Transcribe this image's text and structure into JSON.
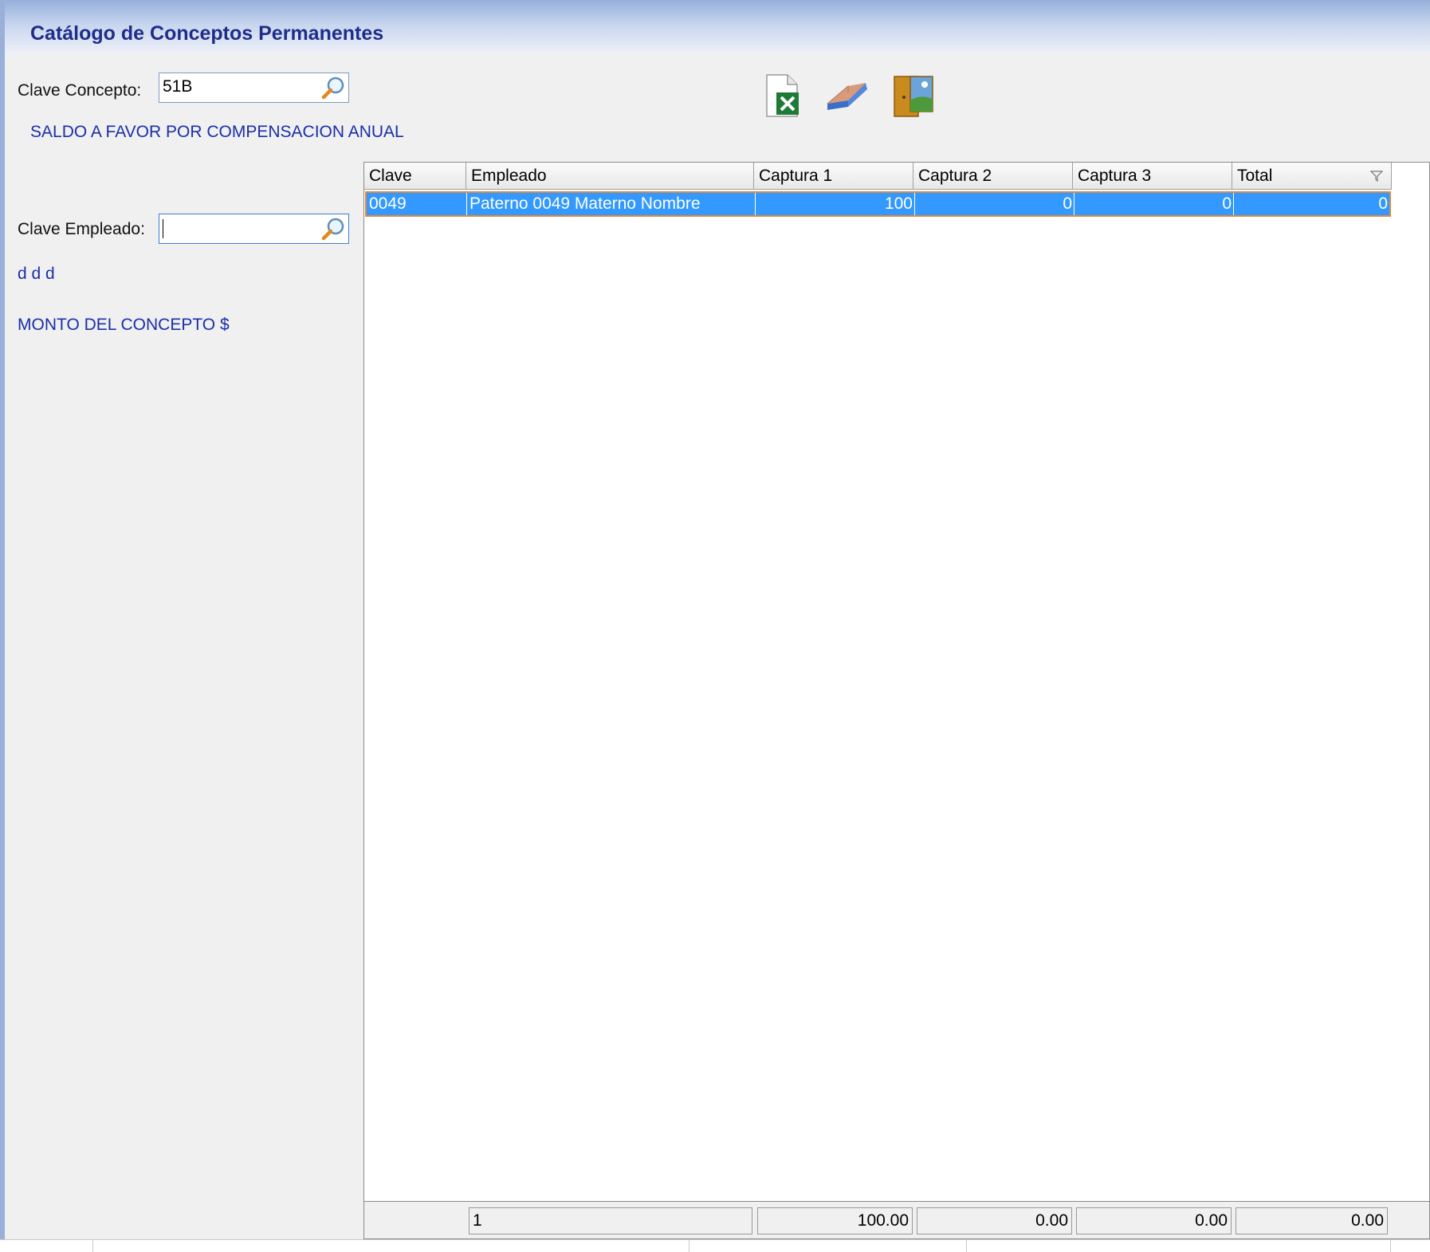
{
  "window": {
    "title": "Catálogo de Conceptos Permanentes"
  },
  "concepto": {
    "label": "Clave Concepto:",
    "value": "51B",
    "description": "SALDO A FAVOR POR COMPENSACION ANUAL"
  },
  "empleado": {
    "label": "Clave Empleado:",
    "value": "",
    "name": "d d d",
    "monto_label": "MONTO DEL CONCEPTO $"
  },
  "toolbar": {
    "icons": [
      "excel-export-icon",
      "eraser-icon",
      "exit-door-icon"
    ]
  },
  "grid": {
    "columns": [
      "Clave",
      "Empleado",
      "Captura 1",
      "Captura 2",
      "Captura 3",
      "Total"
    ],
    "rows": [
      {
        "clave": "0049",
        "empleado": "Paterno 0049 Materno  Nombre",
        "captura1": "100",
        "captura2": "0",
        "captura3": "0",
        "total": "0"
      }
    ],
    "footer": {
      "count": "1",
      "captura1": "100.00",
      "captura2": "0.00",
      "captura3": "0.00",
      "total": "0.00"
    }
  },
  "colors": {
    "selection": "#3399ff",
    "accent_text": "#1a2fa8",
    "title_text": "#1f2d8a",
    "row_border": "#e08a3c"
  }
}
